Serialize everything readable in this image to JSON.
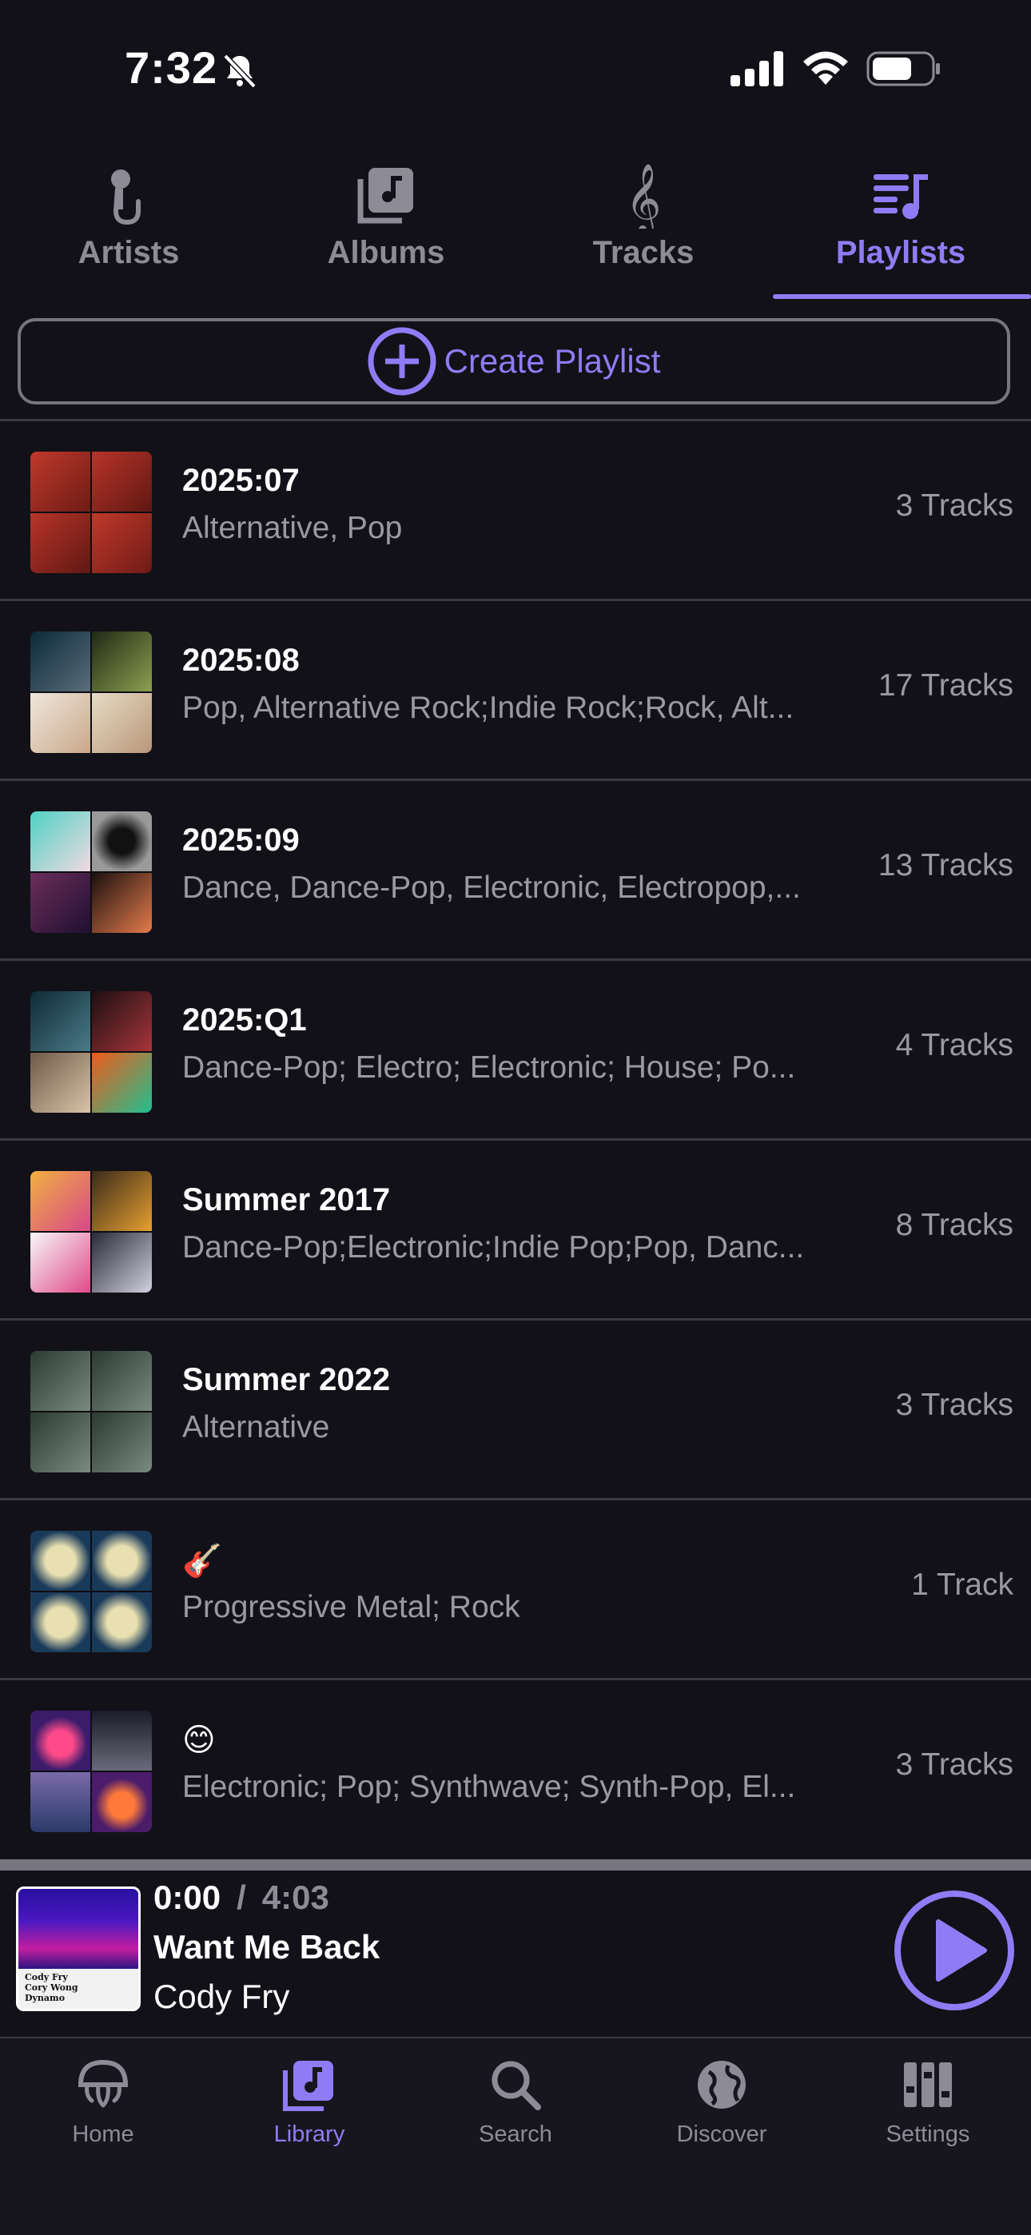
{
  "status_bar": {
    "time": "7:32"
  },
  "top_tabs": [
    {
      "label": "Artists",
      "icon": "microphone-icon"
    },
    {
      "label": "Albums",
      "icon": "album-icon"
    },
    {
      "label": "Tracks",
      "icon": "treble-clef-icon"
    },
    {
      "label": "Playlists",
      "icon": "playlist-icon",
      "active": true
    }
  ],
  "create_playlist_label": "Create Playlist",
  "playlists": [
    {
      "title": "2025:07",
      "genres": "Alternative, Pop",
      "count": "3 Tracks"
    },
    {
      "title": "2025:08",
      "genres": "Pop, Alternative Rock;Indie Rock;Rock, Alt...",
      "count": "17 Tracks"
    },
    {
      "title": "2025:09",
      "genres": "Dance, Dance-Pop, Electronic, Electropop,...",
      "count": "13 Tracks"
    },
    {
      "title": "2025:Q1",
      "genres": "Dance-Pop; Electro; Electronic; House; Po...",
      "count": "4 Tracks"
    },
    {
      "title": "Summer 2017",
      "genres": "Dance-Pop;Electronic;Indie Pop;Pop, Danc...",
      "count": "8 Tracks"
    },
    {
      "title": "Summer 2022",
      "genres": "Alternative",
      "count": "3 Tracks"
    },
    {
      "title": "🎸",
      "genres": "Progressive Metal; Rock",
      "count": "1 Track"
    },
    {
      "title": "😊",
      "genres": "Electronic; Pop; Synthwave; Synth-Pop, El...",
      "count": "3 Tracks"
    }
  ],
  "now_playing": {
    "position": "0:00",
    "separator": "/",
    "duration": "4:03",
    "title": "Want Me Back",
    "artist": "Cody Fry",
    "art_caption": [
      "Cody Fry",
      "Cory Wong",
      "Dynamo"
    ]
  },
  "bottom_nav": [
    {
      "label": "Home",
      "icon": "jellyfish-icon"
    },
    {
      "label": "Library",
      "icon": "library-icon",
      "active": true
    },
    {
      "label": "Search",
      "icon": "search-icon"
    },
    {
      "label": "Discover",
      "icon": "globe-icon"
    },
    {
      "label": "Settings",
      "icon": "settings-icon"
    }
  ],
  "colors": {
    "accent": "#8f7cf5",
    "background": "#121118",
    "muted": "#9a99a3"
  }
}
